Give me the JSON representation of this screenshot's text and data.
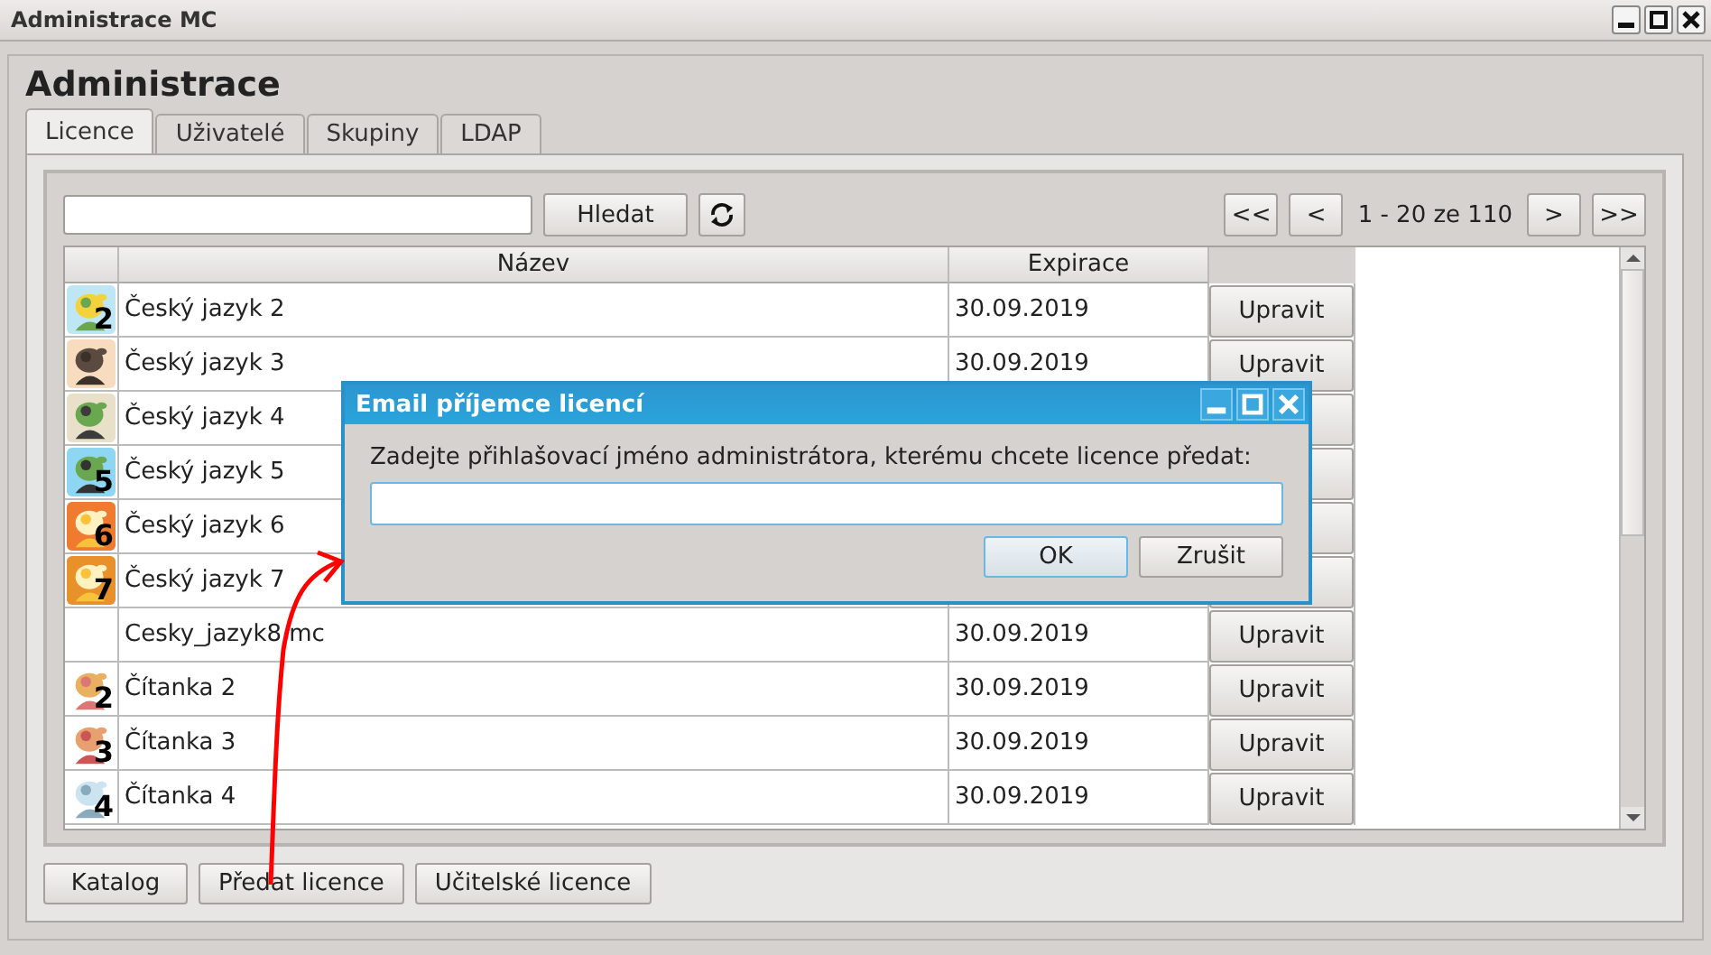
{
  "window": {
    "title": "Administrace MC"
  },
  "heading": "Administrace",
  "tabs": [
    {
      "label": "Licence",
      "selected": true
    },
    {
      "label": "Uživatelé",
      "selected": false
    },
    {
      "label": "Skupiny",
      "selected": false
    },
    {
      "label": "LDAP",
      "selected": false
    }
  ],
  "toolbar": {
    "search_button": "Hledat",
    "pager": {
      "first": "<<",
      "prev": "<",
      "range": "1 - 20 ze 110",
      "next": ">",
      "last": ">>"
    }
  },
  "table": {
    "columns": [
      "Název",
      "Expirace"
    ],
    "rows": [
      {
        "icon": {
          "kind": "picture",
          "badge": "2"
        },
        "name": "Český jazyk 2",
        "expires": "30.09.2019",
        "action": "Upravit"
      },
      {
        "name": "Český jazyk 3",
        "expires": "30.09.2019",
        "action": "Upravit"
      },
      {
        "name": "Český jazyk 4"
      },
      {
        "icon": {
          "kind": "picture",
          "badge": "5"
        },
        "name": "Český jazyk 5"
      },
      {
        "icon": {
          "kind": "picture",
          "badge": "6"
        },
        "name": "Český jazyk 6"
      },
      {
        "icon": {
          "kind": "picture",
          "badge": "7"
        },
        "name": "Český jazyk 7"
      },
      {
        "name": "Cesky_jazyk8.mc",
        "expires": "30.09.2019",
        "action": "Upravit"
      },
      {
        "icon": {
          "kind": "picture",
          "badge": "2"
        },
        "name": "Čítanka 2",
        "expires": "30.09.2019",
        "action": "Upravit"
      },
      {
        "icon": {
          "kind": "picture",
          "badge": "3"
        },
        "name": "Čítanka 3",
        "expires": "30.09.2019",
        "action": "Upravit"
      },
      {
        "icon": {
          "kind": "picture",
          "badge": "4"
        },
        "name": "Čítanka 4",
        "expires": "30.09.2019",
        "action": "Upravit"
      }
    ]
  },
  "buttons": [
    "Katalog",
    "Předat licence",
    "Učitelské licence"
  ],
  "dialog": {
    "title": "Email příjemce licencí",
    "prompt": "Zadejte přihlašovací jméno administrátora, kterému chcete licence předat:",
    "buttons": [
      {
        "label": "OK",
        "default": true
      },
      {
        "label": "Zrušit",
        "default": false
      }
    ]
  },
  "annotation": {
    "kind": "arrow"
  }
}
